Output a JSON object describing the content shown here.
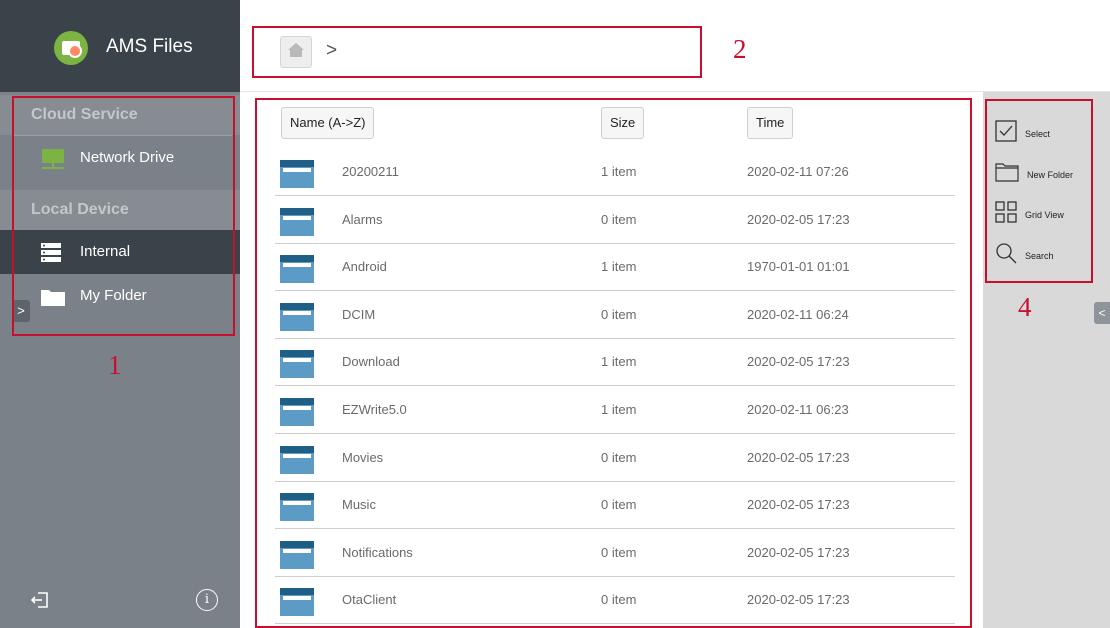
{
  "app": {
    "title": "AMS Files"
  },
  "sidebar": {
    "cloud_section": "Cloud Service",
    "cloud_items": [
      {
        "label": "Network Drive",
        "icon": "network-drive-icon"
      }
    ],
    "local_section": "Local Device",
    "local_items": [
      {
        "label": "Internal",
        "icon": "storage-icon",
        "active": true
      },
      {
        "label": "My Folder",
        "icon": "folder-icon",
        "active": false
      }
    ],
    "expand_glyph": ">",
    "footer": {
      "exit_icon": "exit-icon",
      "info_glyph": "i"
    }
  },
  "breadcrumb": {
    "home_icon": "home-icon",
    "separator": ">"
  },
  "columns": {
    "name": "Name (A->Z)",
    "size": "Size",
    "time": "Time"
  },
  "files": [
    {
      "name": "20200211",
      "size": "1 item",
      "time": "2020-02-11 07:26"
    },
    {
      "name": "Alarms",
      "size": "0 item",
      "time": "2020-02-05 17:23"
    },
    {
      "name": "Android",
      "size": "1 item",
      "time": "1970-01-01 01:01"
    },
    {
      "name": "DCIM",
      "size": "0 item",
      "time": "2020-02-11 06:24"
    },
    {
      "name": "Download",
      "size": "1 item",
      "time": "2020-02-05 17:23"
    },
    {
      "name": "EZWrite5.0",
      "size": "1 item",
      "time": "2020-02-11 06:23"
    },
    {
      "name": "Movies",
      "size": "0 item",
      "time": "2020-02-05 17:23"
    },
    {
      "name": "Music",
      "size": "0 item",
      "time": "2020-02-05 17:23"
    },
    {
      "name": "Notifications",
      "size": "0 item",
      "time": "2020-02-05 17:23"
    },
    {
      "name": "OtaClient",
      "size": "0 item",
      "time": "2020-02-05 17:23"
    }
  ],
  "tools": [
    {
      "label": "Select",
      "icon": "checkbox-icon"
    },
    {
      "label": "New Folder",
      "icon": "new-folder-icon"
    },
    {
      "label": "Grid View",
      "icon": "grid-icon"
    },
    {
      "label": "Search",
      "icon": "search-icon"
    }
  ],
  "right_toggle_glyph": "<",
  "annotations": [
    "1",
    "2",
    "4"
  ],
  "colors": {
    "sidebar": "#7b8188",
    "sidebar_header": "#3a434a",
    "folder": "#5b9bc5",
    "network_drive": "#7cb342",
    "annotation": "#c8102e",
    "tool_panel": "#d9d9d9"
  }
}
